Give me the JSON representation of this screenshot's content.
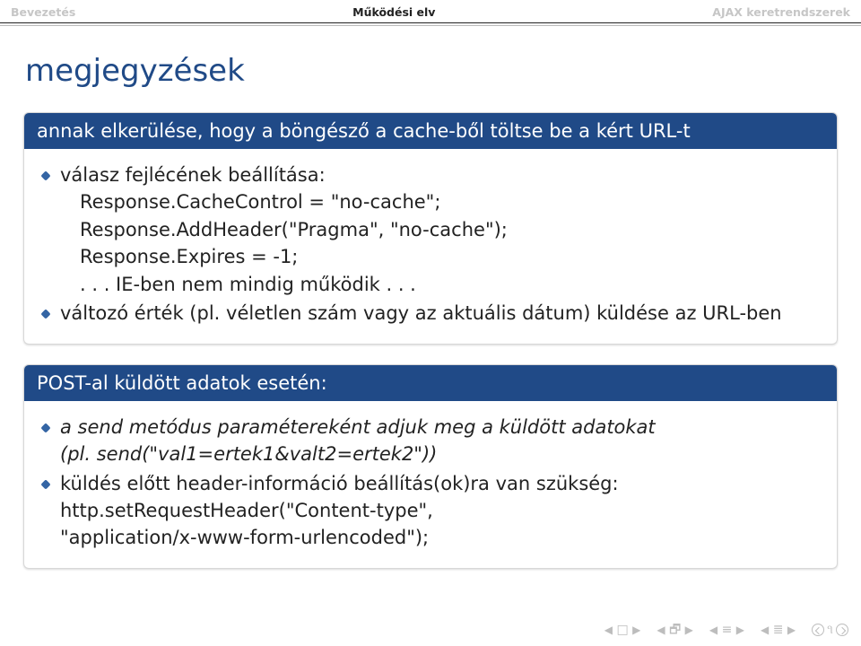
{
  "header": {
    "left": "Bevezetés",
    "center": "Működési elv",
    "right": "AJAX keretrendszerek"
  },
  "title": "megjegyzések",
  "block1": {
    "heading": "annak elkerülése, hogy a böngésző a cache-ből töltse be a kért URL-t",
    "item1_a": "válasz fejlécének beállítása:",
    "item1_b": "Response.CacheControl = \"no-cache\";",
    "item1_c": "Response.AddHeader(\"Pragma\", \"no-cache\");",
    "item1_d": "Response.Expires = -1;",
    "item1_e": ". . . IE-ben nem mindig működik . . .",
    "item2": "változó érték (pl. véletlen szám vagy az aktuális dátum) küldése az URL-ben"
  },
  "block2": {
    "heading": "POST-al küldött adatok esetén:",
    "item1_a": "a send metódus paramétereként adjuk meg a küldött adatokat",
    "item1_b": "(pl. send(\"val1=ertek1&valt2=ertek2\"))",
    "item2_a": "küldés előtt header-információ beállítás(ok)ra van szükség:",
    "item2_b": "http.setRequestHeader(\"Content-type\",",
    "item2_c": "\"application/x-www-form-urlencoded\");"
  }
}
